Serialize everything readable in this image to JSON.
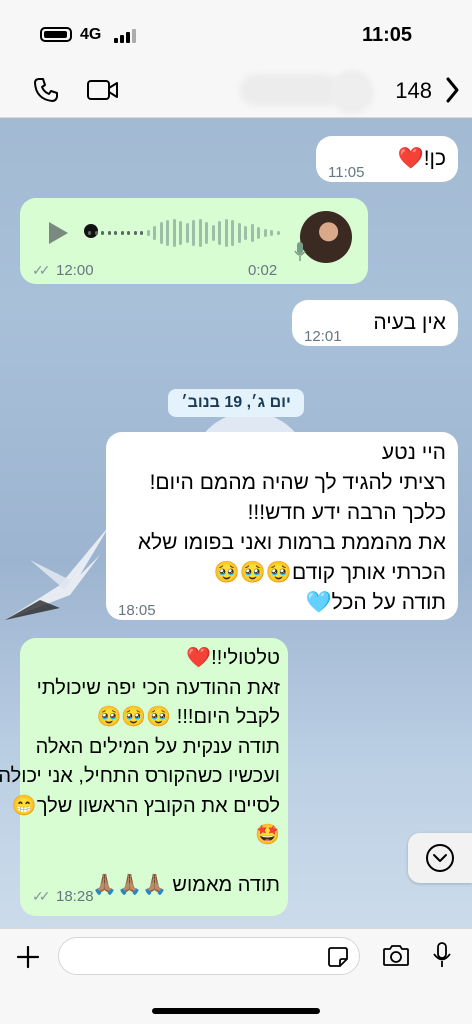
{
  "status_bar": {
    "network": "4G",
    "time": "11:05"
  },
  "header": {
    "unread_count": "148"
  },
  "messages": [
    {
      "id": "m1",
      "direction": "in",
      "text": "כן!",
      "emoji": "❤️",
      "time": "11:05"
    },
    {
      "id": "m2",
      "direction": "out",
      "type": "voice",
      "duration": "0:02",
      "time": "12:00",
      "status": "read"
    },
    {
      "id": "m3",
      "direction": "in",
      "text": "אין בעיה",
      "time": "12:01"
    },
    {
      "id": "m4",
      "direction": "in",
      "lines": [
        "היי נטע",
        "רציתי להגיד לך שהיה מהמם היום!",
        "כלכך הרבה ידע חדש!!!",
        "את מהממת ברמות ואני בפומו שלא",
        "הכרתי אותך קודם🥹🥹🥹",
        "תודה על הכל🩵"
      ],
      "time": "18:05"
    },
    {
      "id": "m5",
      "direction": "out",
      "lines": [
        "טלטולי!!❤️",
        "זאת ההודעה הכי יפה שיכולתי",
        "לקבל היום!!! 🥹🥹🥹",
        "תודה ענקית על המילים האלה",
        "ועכשיו כשהקורס התחיל, אני יכולה",
        "לסיים את הקובץ הראשון שלך😁",
        "🤩",
        "",
        "תודה מאמוש 🙏🏽🙏🏽🙏🏽"
      ],
      "time": "18:28",
      "status": "read"
    }
  ],
  "date_separator": "יום ג׳, 19 בנוב׳",
  "colors": {
    "incoming_bubble": "#ffffff",
    "outgoing_bubble": "#d9fdd3",
    "timestamp": "#667781",
    "read_ticks": "#8696a0"
  },
  "icons": [
    "phone-icon",
    "video-call-icon",
    "back-chevron-icon",
    "play-icon",
    "mic-icon",
    "plus-icon",
    "sticker-icon",
    "camera-icon",
    "chevron-down-icon"
  ]
}
